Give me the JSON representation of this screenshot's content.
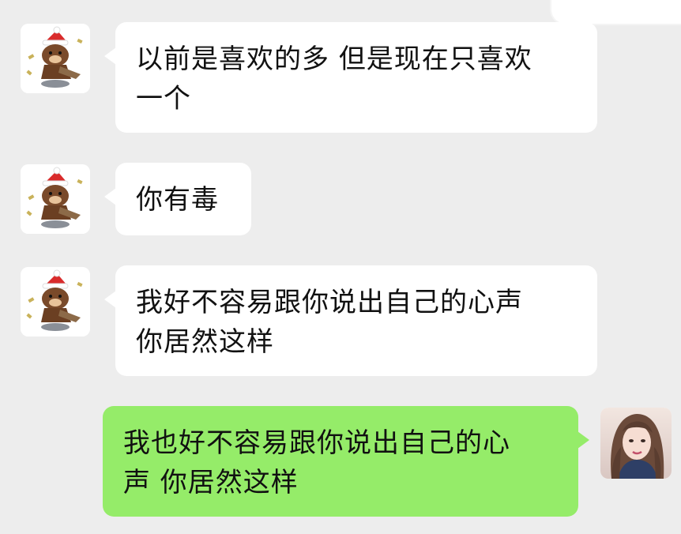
{
  "chat": {
    "messages": [
      {
        "sender": "other",
        "avatar_icon": "brown-bear-santa-hat-avatar-icon",
        "lines": [
          "以前是喜欢的多 但是现在只喜欢",
          "一个"
        ]
      },
      {
        "sender": "other",
        "avatar_icon": "brown-bear-santa-hat-avatar-icon",
        "lines": [
          "你有毒"
        ]
      },
      {
        "sender": "other",
        "avatar_icon": "brown-bear-santa-hat-avatar-icon",
        "lines": [
          "我好不容易跟你说出自己的心声",
          "你居然这样"
        ]
      },
      {
        "sender": "self",
        "avatar_icon": "girl-portrait-avatar-icon",
        "lines": [
          "我也好不容易跟你说出自己的心",
          "声 你居然这样"
        ]
      }
    ]
  },
  "colors": {
    "background": "#ededed",
    "incoming_bubble": "#ffffff",
    "outgoing_bubble": "#95ec69",
    "text": "#111111"
  }
}
